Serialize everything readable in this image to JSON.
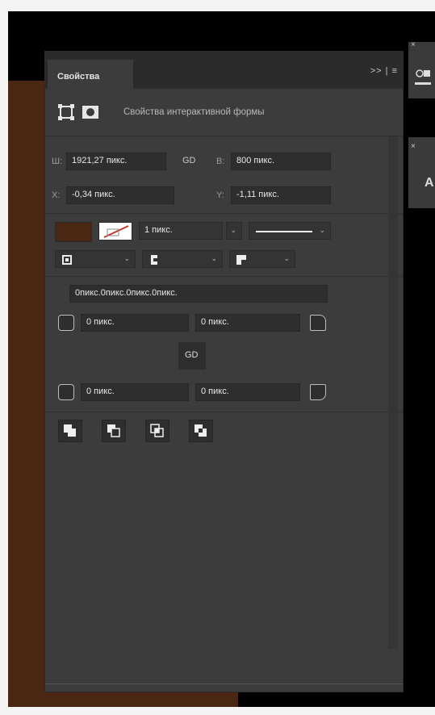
{
  "panel": {
    "tab_title": "Свойства",
    "tab_tools": ">> | ≡",
    "section_title": "Свойства интерактивной формы"
  },
  "transform": {
    "width_label": "Ш:",
    "width_value": "1921,27 пикс.",
    "link_glyph": "GD",
    "height_label": "В:",
    "height_value": "800 пикс.",
    "x_label": "X:",
    "x_value": "-0,34 пикс.",
    "y_label": "Y:",
    "y_value": "-1,11 пикс."
  },
  "appearance": {
    "fill_color": "#4a2713",
    "stroke_width": "1 пикс."
  },
  "corners": {
    "combined": "0пикс.0пикс.0пикс.0пикс.",
    "top_left": "0 пикс.",
    "top_right": "0 пикс.",
    "link_glyph": "GD",
    "bottom_left": "0 пикс.",
    "bottom_right": "0 пикс."
  },
  "right_panels": {
    "top_close": "×",
    "second_close": "×",
    "second_letter": "A"
  },
  "icons": {
    "transform": "bounding-box-icon",
    "mask": "mask-icon",
    "link": "link-icon",
    "stroke_none": "stroke-none-icon",
    "align": "align-stroke-icon",
    "cap": "cap-icon",
    "corner": "corner-icon",
    "pathfinder": [
      "combine-shapes-icon",
      "subtract-shape-icon",
      "intersect-shapes-icon",
      "exclude-shapes-icon"
    ]
  }
}
